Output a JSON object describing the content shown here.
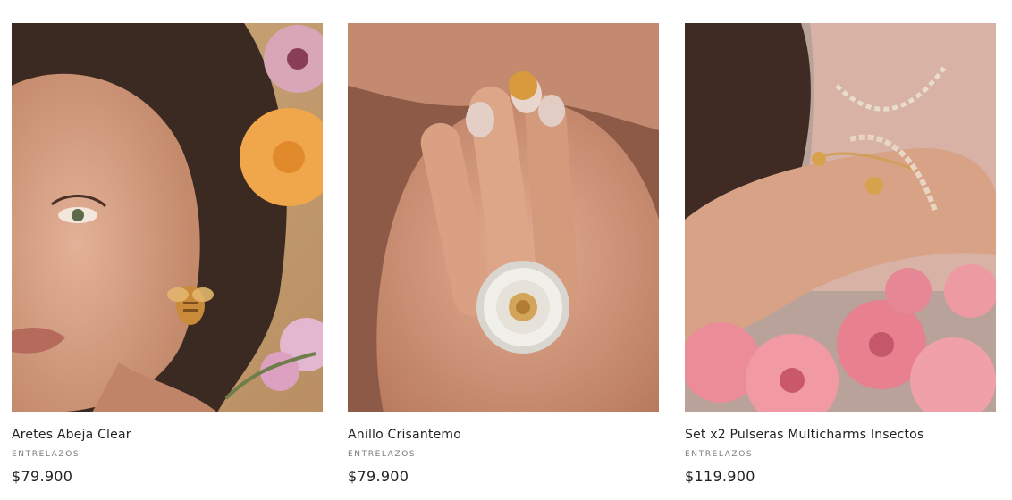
{
  "products": [
    {
      "title": "Aretes Abeja Clear",
      "brand": "ENTRELAZOS",
      "price": "$79.900",
      "image_icon": "bee-earring-photo-icon"
    },
    {
      "title": "Anillo Crisantemo",
      "brand": "ENTRELAZOS",
      "price": "$79.900",
      "image_icon": "chrysanthemum-ring-photo-icon"
    },
    {
      "title": "Set x2 Pulseras Multicharms Insectos",
      "brand": "ENTRELAZOS",
      "price": "$119.900",
      "image_icon": "charm-bracelets-photo-icon"
    }
  ],
  "colors": {
    "text": "#222222",
    "muted": "#7a7a7a",
    "gold": "#c98a3a",
    "skin": "#d9a487",
    "petal_pink": "#e8909c"
  }
}
